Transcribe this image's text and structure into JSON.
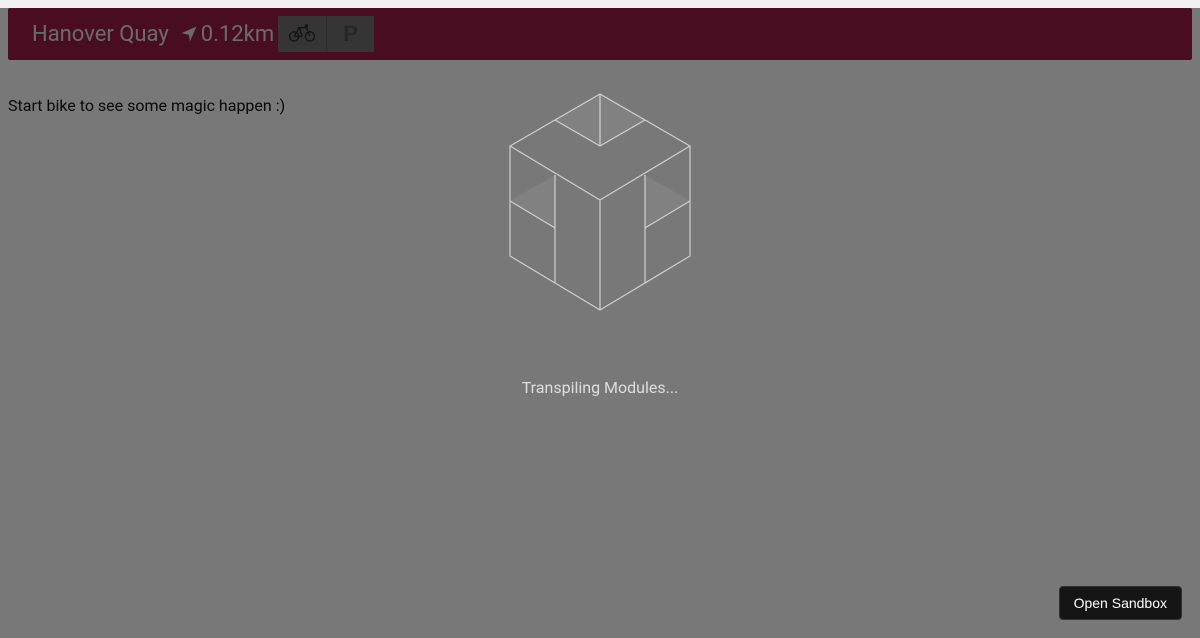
{
  "header": {
    "station_name": "Hanover Quay",
    "distance": "0.12km",
    "nav_icon": "navigation-arrow-icon",
    "badges": {
      "bike": "bike-icon",
      "parking_letter": "P"
    }
  },
  "hint": "Start bike to see some magic happen :)",
  "overlay": {
    "loading_text": "Transpiling Modules..."
  },
  "open_sandbox_label": "Open Sandbox"
}
